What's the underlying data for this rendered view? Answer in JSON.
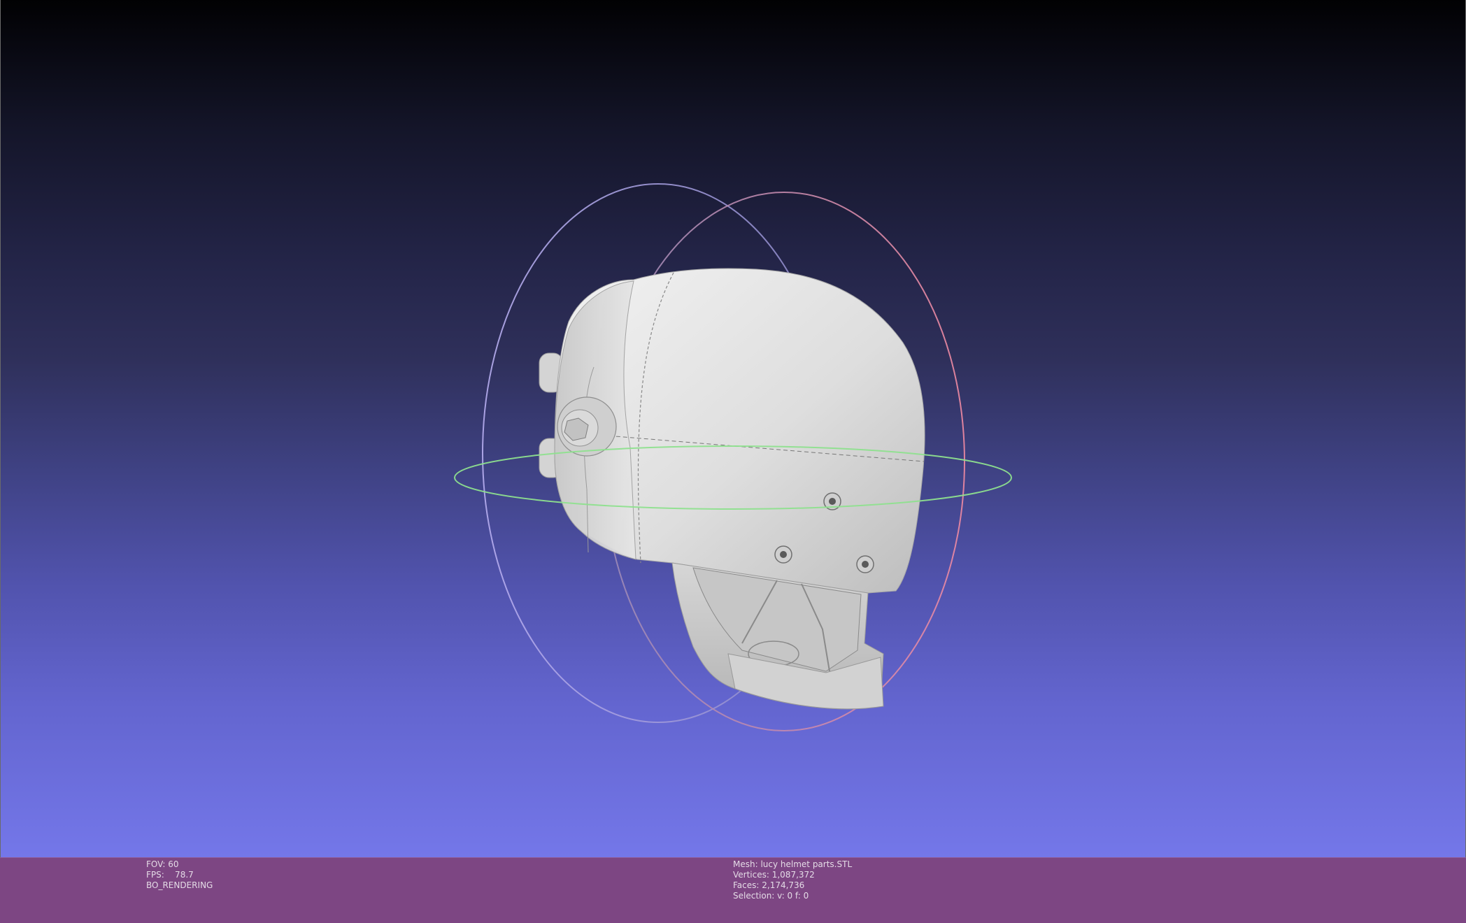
{
  "window": {
    "title": "MeshLab 3D viewport"
  },
  "viewport": {
    "background_top": "#010103",
    "background_bottom": "#7477e9",
    "trackball_colors": {
      "horizontal": "#8ee08e",
      "vertical_left": "#b0a6e8",
      "vertical_right": "#e88aa0"
    },
    "mesh_color": "#d9d9d9"
  },
  "status_left": {
    "fov": "FOV: 60",
    "fps": "FPS:    78.7",
    "mode": "BO_RENDERING"
  },
  "status_right": {
    "mesh": "Mesh: lucy helmet parts.STL",
    "vertices": "Vertices: 1,087,372",
    "faces": "Faces: 2,174,736",
    "selection": "Selection: v: 0 f: 0"
  },
  "info_bar_color": "#7d4683"
}
